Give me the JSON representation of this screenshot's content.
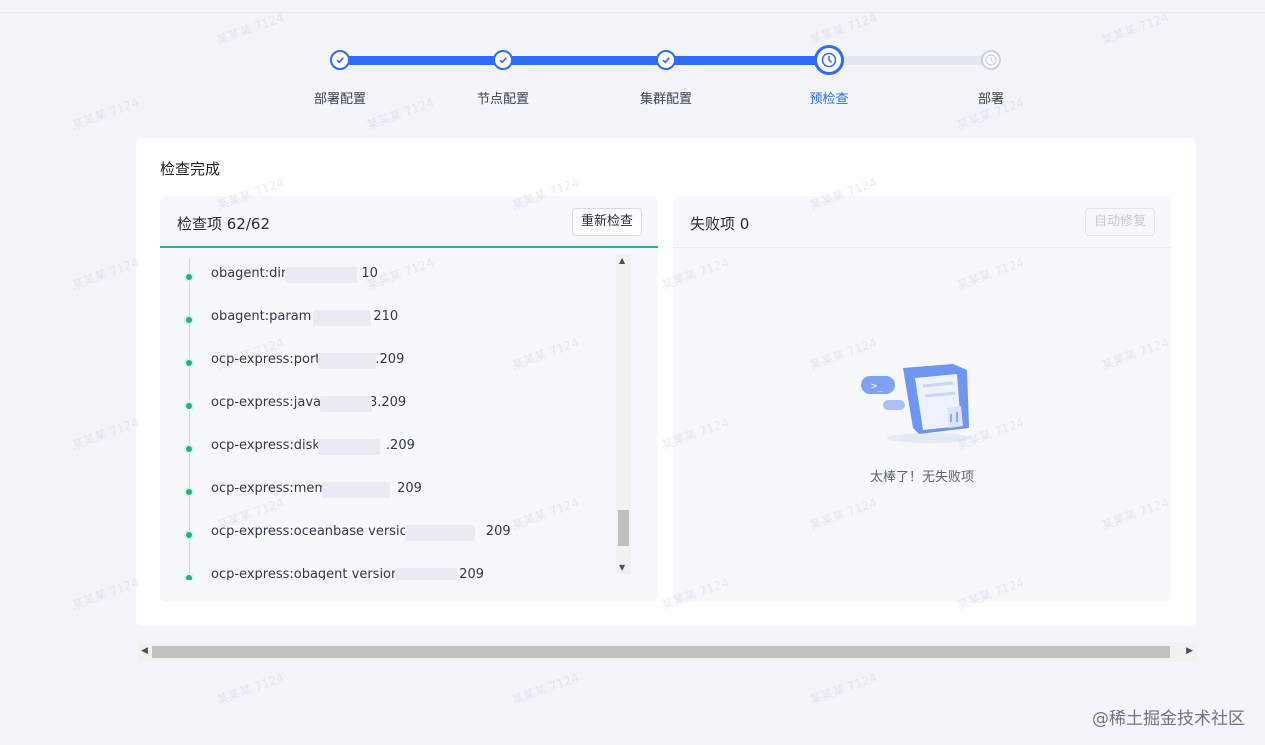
{
  "stepper": {
    "steps": [
      {
        "label": "部署配置",
        "status": "done"
      },
      {
        "label": "节点配置",
        "status": "done"
      },
      {
        "label": "集群配置",
        "status": "done"
      },
      {
        "label": "预检查",
        "status": "current"
      },
      {
        "label": "部署",
        "status": "pending"
      }
    ]
  },
  "card": {
    "title": "检查完成"
  },
  "check_panel": {
    "title": "检查项 62/62",
    "recheck_button": "重新检查",
    "items": [
      {
        "prefix": "obagent:dir",
        "suffix": "10"
      },
      {
        "prefix": "obagent:param",
        "suffix": "210"
      },
      {
        "prefix": "ocp-express:port",
        "suffix": ".209"
      },
      {
        "prefix": "ocp-express:java",
        "suffix": "3.209"
      },
      {
        "prefix": "ocp-express:disk",
        "suffix": ".209"
      },
      {
        "prefix": "ocp-express:mem",
        "suffix": "209"
      },
      {
        "prefix": "ocp-express:oceanbase version",
        "suffix": "209"
      },
      {
        "prefix": "ocp-express:obagent version",
        "suffix": "209"
      }
    ]
  },
  "fail_panel": {
    "title": "失败项 0",
    "autofix_button": "自动修复",
    "empty_text": "太棒了！无失败项"
  },
  "watermark": {
    "corner_text": "@稀土掘金技术社区",
    "tiled_text": "某某某 7124"
  }
}
